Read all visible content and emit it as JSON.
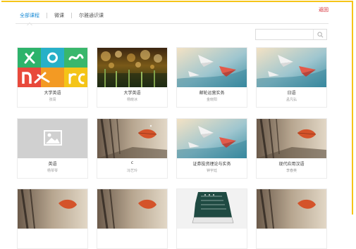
{
  "tabs": [
    {
      "label": "全部课程",
      "active": true
    },
    {
      "label": "微课",
      "active": false
    },
    {
      "label": "尔雅通识课",
      "active": false
    }
  ],
  "return_label": "返回",
  "search": {
    "placeholder": ""
  },
  "colors": {
    "accent": "#1a8bd6",
    "return": "#d2202a",
    "frame": "#f5c518"
  },
  "courses": [
    {
      "title": "大学英语",
      "teacher": "张闯",
      "thumb": "app-icon-grid"
    },
    {
      "title": "大学英语",
      "teacher": "杨晓冰",
      "thumb": "bokeh-photo"
    },
    {
      "title": "邮轮运营实务",
      "teacher": "金晓阳",
      "thumb": "paper-planes"
    },
    {
      "title": "日语",
      "teacher": "孟凡弘",
      "thumb": "paper-planes"
    },
    {
      "title": "英语",
      "teacher": "杨琴琴",
      "thumb": "image-placeholder"
    },
    {
      "title": "c",
      "teacher": "冯艺玲",
      "thumb": "autumn-leaf"
    },
    {
      "title": "证券投资理论与实务",
      "teacher": "钟宇廷",
      "thumb": "paper-planes"
    },
    {
      "title": "现代应用汉语",
      "teacher": "李春英",
      "thumb": "autumn-leaf"
    },
    {
      "title": "",
      "teacher": "",
      "thumb": "autumn-leaf"
    },
    {
      "title": "",
      "teacher": "",
      "thumb": "autumn-leaf"
    },
    {
      "title": "",
      "teacher": "",
      "thumb": "sneaker-chalkboard"
    },
    {
      "title": "",
      "teacher": "",
      "thumb": "autumn-leaf"
    }
  ]
}
